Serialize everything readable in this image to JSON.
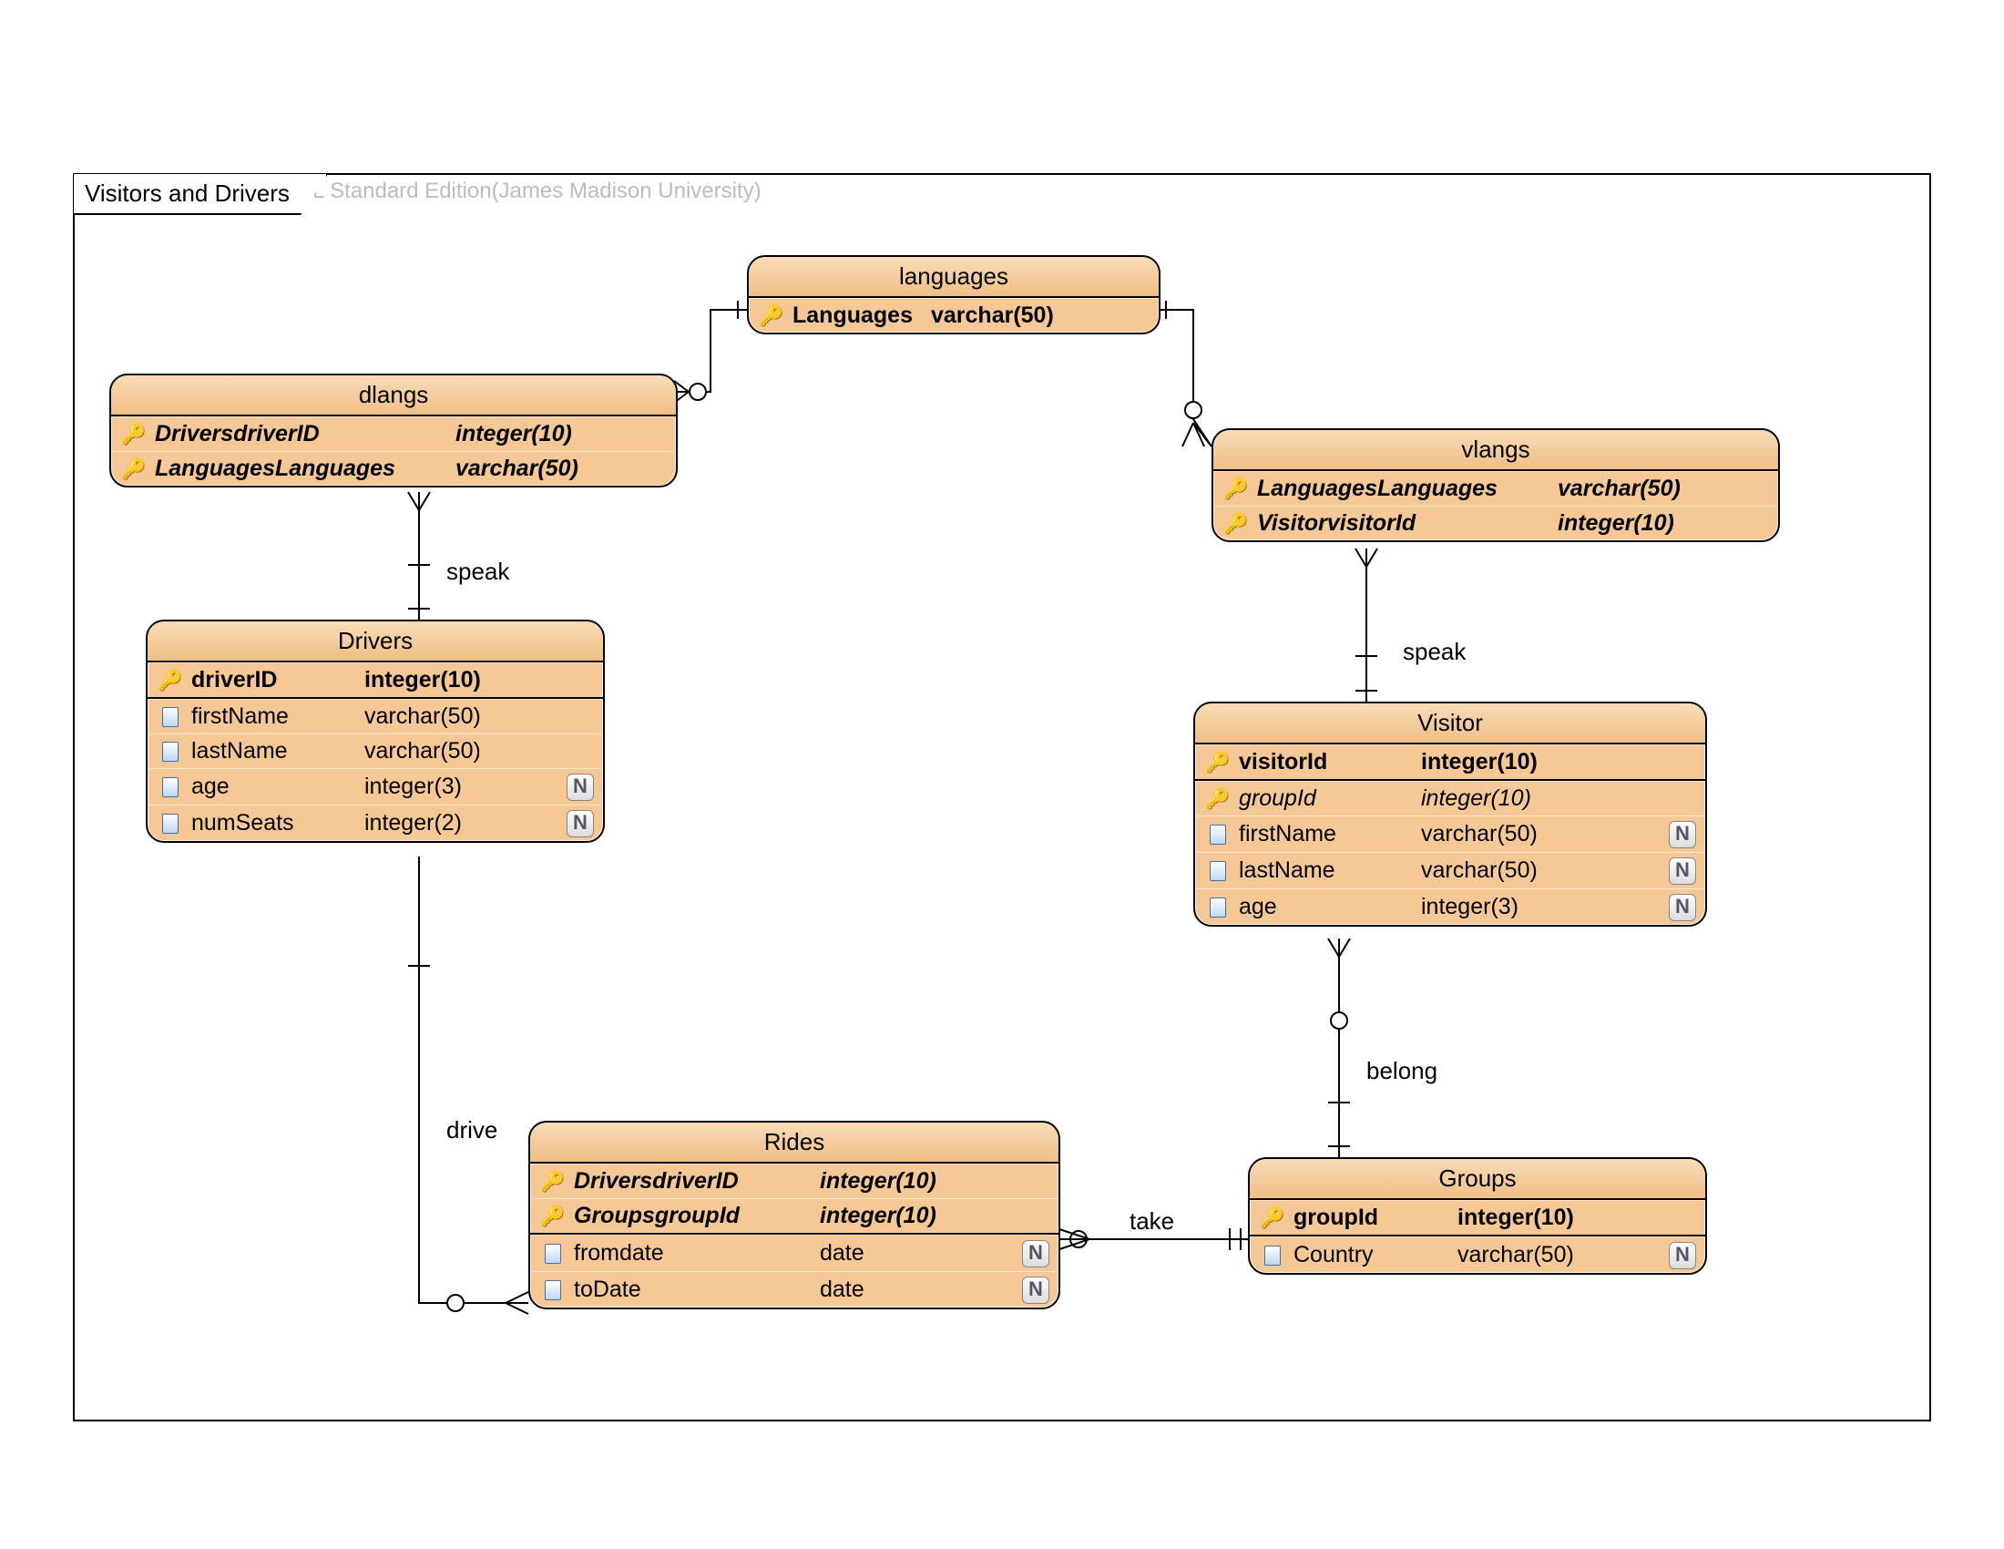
{
  "watermark": "Visual Paradigm for UML Standard Edition(James Madison University)",
  "frame": {
    "title": "Visitors and Drivers"
  },
  "entities": {
    "languages": {
      "title": "languages",
      "cols": [
        {
          "icon": "pk",
          "name": "Languages",
          "type": "varchar(50)",
          "bold": true
        }
      ]
    },
    "dlangs": {
      "title": "dlangs",
      "cols": [
        {
          "icon": "fk",
          "name": "DriversdriverID",
          "type": "integer(10)",
          "bold": true,
          "italic": true
        },
        {
          "icon": "fk",
          "name": "LanguagesLanguages",
          "type": "varchar(50)",
          "bold": true,
          "italic": true
        }
      ]
    },
    "vlangs": {
      "title": "vlangs",
      "cols": [
        {
          "icon": "fk",
          "name": "LanguagesLanguages",
          "type": "varchar(50)",
          "bold": true,
          "italic": true
        },
        {
          "icon": "fk",
          "name": "VisitorvisitorId",
          "type": "integer(10)",
          "bold": true,
          "italic": true
        }
      ]
    },
    "drivers": {
      "title": "Drivers",
      "cols": [
        {
          "icon": "pk",
          "name": "driverID",
          "type": "integer(10)",
          "bold": true
        },
        {
          "icon": "col",
          "name": "firstName",
          "type": "varchar(50)"
        },
        {
          "icon": "col",
          "name": "lastName",
          "type": "varchar(50)"
        },
        {
          "icon": "col",
          "name": "age",
          "type": "integer(3)",
          "null": true
        },
        {
          "icon": "col",
          "name": "numSeats",
          "type": "integer(2)",
          "null": true
        }
      ]
    },
    "visitor": {
      "title": "Visitor",
      "cols": [
        {
          "icon": "pk",
          "name": "visitorId",
          "type": "integer(10)",
          "bold": true
        },
        {
          "icon": "fk",
          "name": "groupId",
          "type": "integer(10)",
          "italic": true
        },
        {
          "icon": "col",
          "name": "firstName",
          "type": "varchar(50)",
          "null": true
        },
        {
          "icon": "col",
          "name": "lastName",
          "type": "varchar(50)",
          "null": true
        },
        {
          "icon": "col",
          "name": "age",
          "type": "integer(3)",
          "null": true
        }
      ]
    },
    "rides": {
      "title": "Rides",
      "cols": [
        {
          "icon": "fk",
          "name": "DriversdriverID",
          "type": "integer(10)",
          "bold": true,
          "italic": true
        },
        {
          "icon": "fk",
          "name": "GroupsgroupId",
          "type": "integer(10)",
          "bold": true,
          "italic": true
        },
        {
          "icon": "col",
          "name": "fromdate",
          "type": "date",
          "null": true
        },
        {
          "icon": "col",
          "name": "toDate",
          "type": "date",
          "null": true
        }
      ]
    },
    "groups": {
      "title": "Groups",
      "cols": [
        {
          "icon": "pk",
          "name": "groupId",
          "type": "integer(10)",
          "bold": true
        },
        {
          "icon": "col",
          "name": "Country",
          "type": "varchar(50)",
          "null": true
        }
      ]
    }
  },
  "relations": {
    "speak1": "speak",
    "speak2": "speak",
    "drive": "drive",
    "take": "take",
    "belong": "belong"
  },
  "n_badge": "N"
}
